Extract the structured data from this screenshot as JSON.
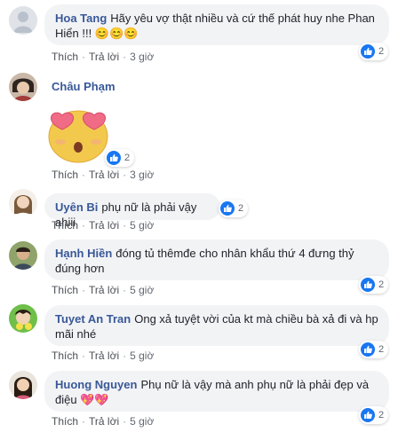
{
  "comments": [
    {
      "name": "Hoa Tang",
      "text": "Hãy yêu vợ thật nhiều và cứ thế phát huy nhe Phan Hiển !!!",
      "emoji": "😊😊😊",
      "actions": {
        "like": "Thích",
        "reply": "Trả lời",
        "time": "3 giờ"
      },
      "reactions": "2"
    },
    {
      "name": "Châu Phạm",
      "sticker": "heart-eyes-sticker",
      "actions": {
        "like": "Thích",
        "reply": "Trả lời",
        "time": "3 giờ"
      },
      "reactions": "2"
    },
    {
      "name": "Uyên Bi",
      "text": "phụ nữ là phải vậy ahiii",
      "actions": {
        "like": "Thích",
        "reply": "Trả lời",
        "time": "5 giờ"
      },
      "reactions": "2"
    },
    {
      "name": "Hạnh Hiền",
      "text": "đóng tủ thêmđe cho nhân khẩu thứ 4 đưng thỷ đúng hơn",
      "actions": {
        "like": "Thích",
        "reply": "Trả lời",
        "time": "5 giờ"
      },
      "reactions": "2"
    },
    {
      "name": "Tuyet An Tran",
      "text": "Ong xả tuyệt vời của kt mà chiều bà xả đi và hp mãi nhé",
      "actions": {
        "like": "Thích",
        "reply": "Trả lời",
        "time": "5 giờ"
      },
      "reactions": "2"
    },
    {
      "name": "Huong Nguyen",
      "text": "Phụ nữ là vậy mà anh phụ nữ là phải đẹp và điệu",
      "emoji": "💖💖",
      "actions": {
        "like": "Thích",
        "reply": "Trả lời",
        "time": "5 giờ"
      },
      "reactions": "2"
    }
  ],
  "colors": {
    "name": "#385898",
    "bubble": "#f2f3f5",
    "like": "#1877f2"
  },
  "icons": {
    "like": "thumbs-up-icon",
    "emoji_smile": "smiling-face-icon",
    "heart": "sparkling-heart-icon"
  }
}
